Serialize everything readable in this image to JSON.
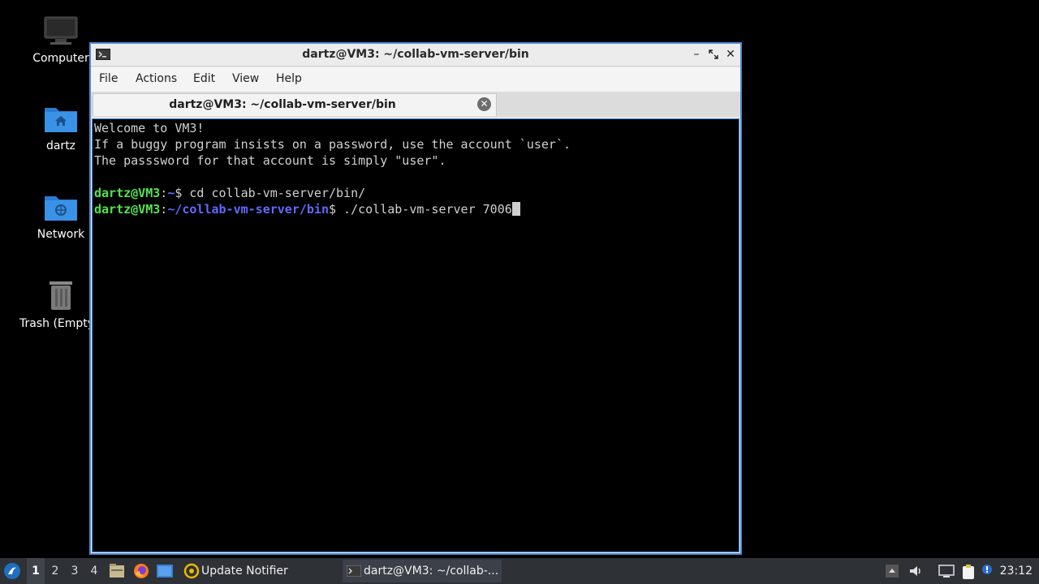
{
  "desktop": {
    "icons": [
      {
        "label": "Computer"
      },
      {
        "label": "dartz"
      },
      {
        "label": "Network"
      },
      {
        "label": "Trash (Empty)"
      }
    ]
  },
  "window": {
    "title": "dartz@VM3: ~/collab-vm-server/bin",
    "menu": [
      "File",
      "Actions",
      "Edit",
      "View",
      "Help"
    ],
    "tab_label": "dartz@VM3: ~/collab-vm-server/bin"
  },
  "terminal": {
    "welcome": "Welcome to VM3!",
    "line2": "If a buggy program insists on a password, use the account `user`.",
    "line3": "The passsword for that account is simply \"user\".",
    "prompt1_user": "dartz@VM3",
    "prompt1_sep": ":",
    "prompt1_path": "~",
    "prompt1_cmd": "$ cd collab-vm-server/bin/",
    "prompt2_user": "dartz@VM3",
    "prompt2_sep": ":",
    "prompt2_path": "~/collab-vm-server/bin",
    "prompt2_cmd": "$ ./collab-vm-server 7006"
  },
  "taskbar": {
    "desktops": [
      "1",
      "2",
      "3",
      "4"
    ],
    "tasks": [
      {
        "label": "Update Notifier"
      },
      {
        "label": "dartz@VM3: ~/collab-..."
      }
    ],
    "clock": "23:12"
  },
  "colors": {
    "window_border": "#4b8bd4",
    "prompt_user": "#54e350",
    "prompt_path": "#5d6bff",
    "taskbar_bg": "#2e3136"
  }
}
